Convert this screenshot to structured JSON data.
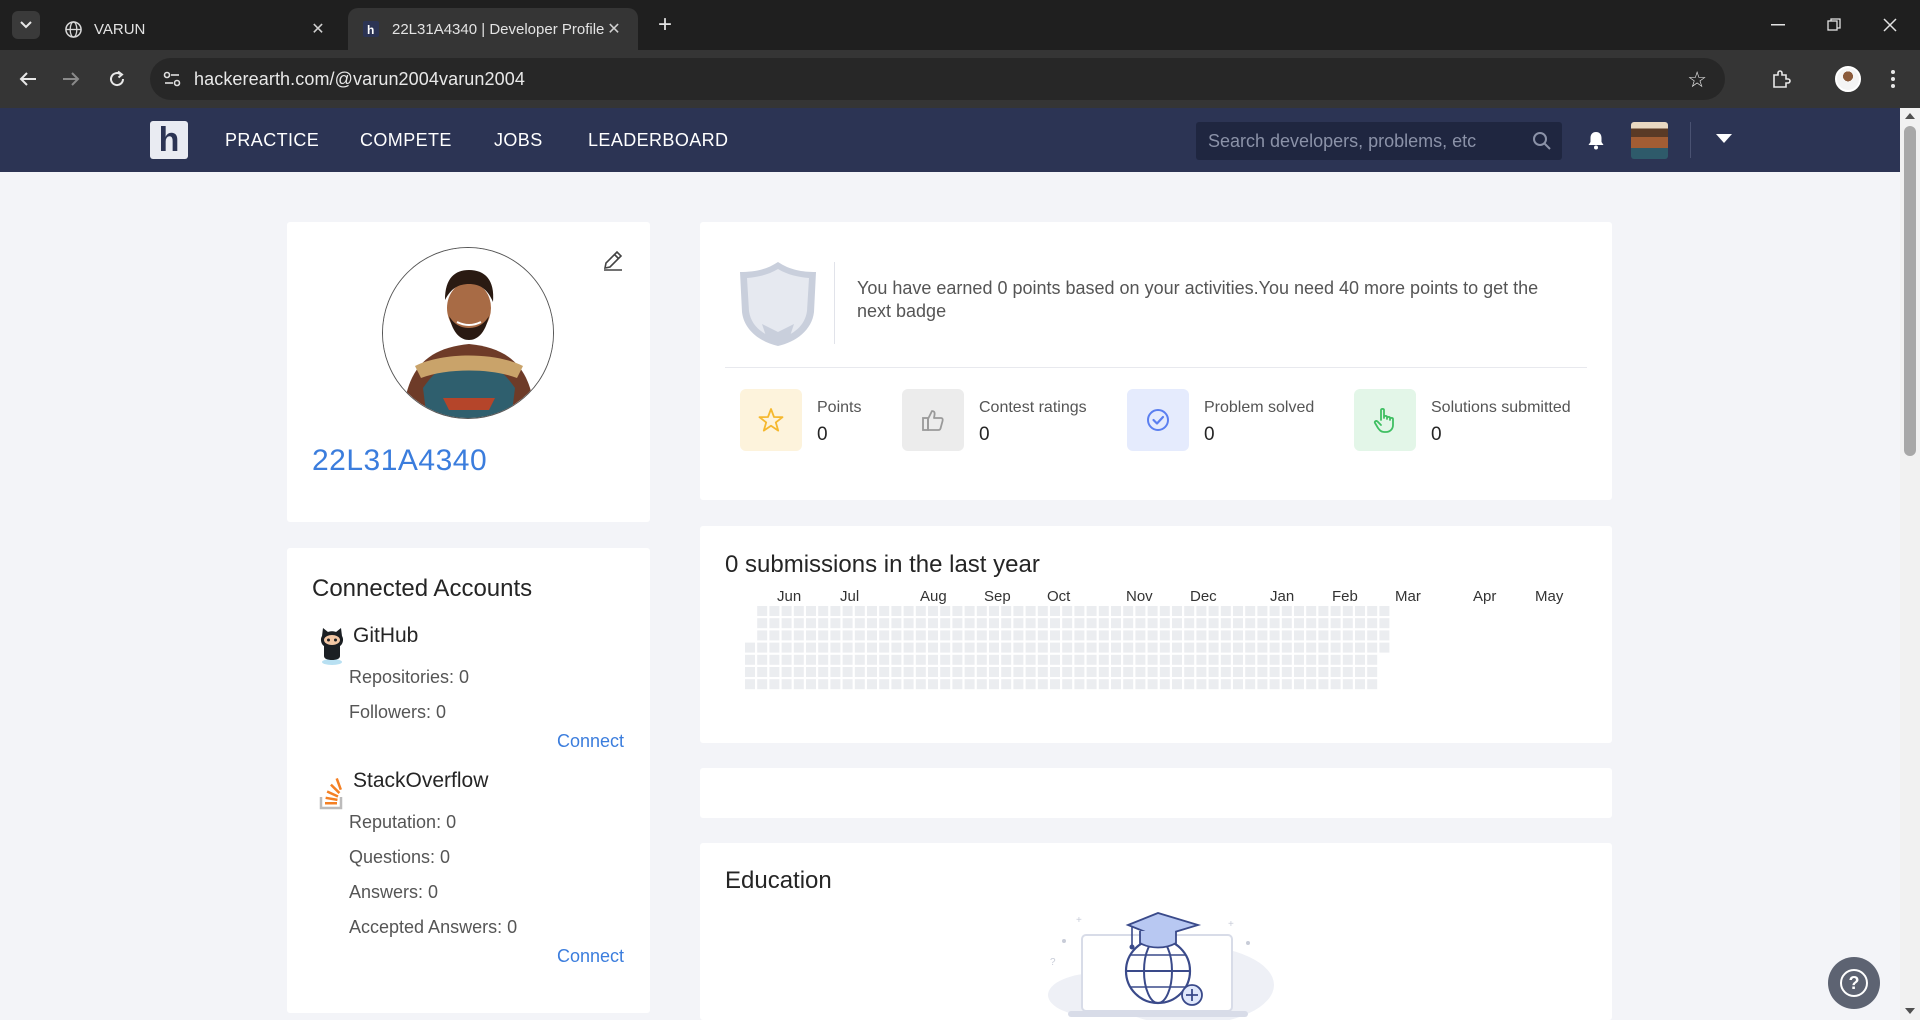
{
  "browser": {
    "tabs": [
      {
        "title": "VARUN",
        "icon": "globe-icon",
        "active": false
      },
      {
        "title": "22L31A4340 | Developer Profile",
        "icon": "hackerearth-favicon",
        "active": true
      }
    ],
    "url": "hackerearth.com/@varun2004varun2004"
  },
  "site": {
    "logo_letter": "h",
    "nav": [
      "PRACTICE",
      "COMPETE",
      "JOBS",
      "LEADERBOARD"
    ],
    "search_placeholder": "Search developers, problems, etc"
  },
  "profile": {
    "username": "22L31A4340"
  },
  "accounts": {
    "title": "Connected Accounts",
    "github": {
      "name": "GitHub",
      "stats": [
        "Repositories: 0",
        "Followers: 0"
      ],
      "connect": "Connect"
    },
    "stackoverflow": {
      "name": "StackOverflow",
      "stats": [
        "Reputation: 0",
        "Questions: 0",
        "Answers: 0",
        "Accepted Answers: 0"
      ],
      "connect": "Connect"
    }
  },
  "points": {
    "badge_text": "You have earned 0 points based on your activities.You need 40 more points to get the next badge",
    "stats": [
      {
        "label": "Points",
        "value": "0",
        "icon": "star-icon",
        "color": "#f5b82e"
      },
      {
        "label": "Contest ratings",
        "value": "0",
        "icon": "thumbs-up-icon",
        "color": "#9a9a9a"
      },
      {
        "label": "Problem solved",
        "value": "0",
        "icon": "check-circle-icon",
        "color": "#5b7ff0"
      },
      {
        "label": "Solutions submitted",
        "value": "0",
        "icon": "pointer-hand-icon",
        "color": "#3fbf62"
      }
    ]
  },
  "submissions": {
    "title": "0 submissions in the last year",
    "months": [
      "Jun",
      "Jul",
      "Aug",
      "Sep",
      "Oct",
      "Nov",
      "Dec",
      "Jan",
      "Feb",
      "Mar",
      "Apr",
      "May"
    ]
  },
  "education": {
    "title": "Education"
  },
  "help": {
    "label": "?"
  }
}
